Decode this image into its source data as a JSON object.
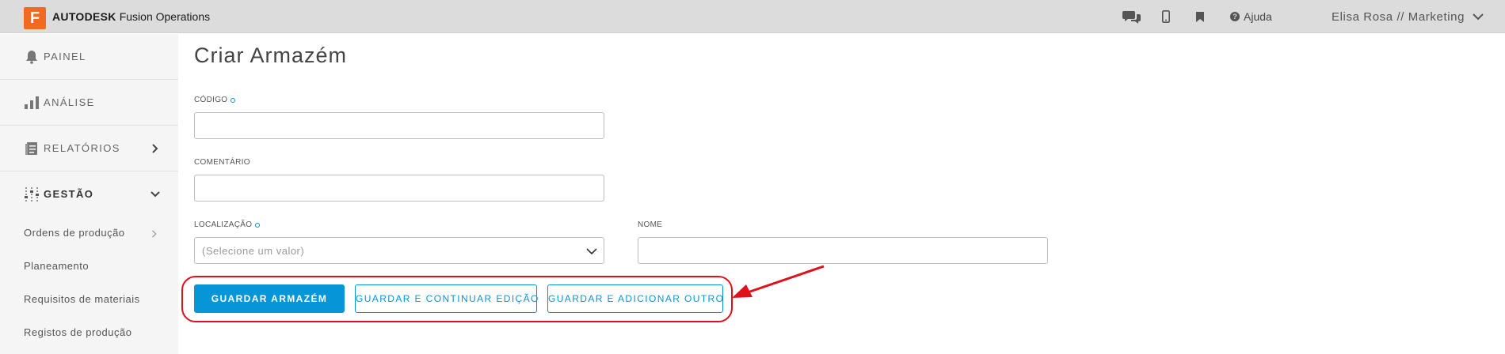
{
  "topbar": {
    "logo_letter": "F",
    "brand_name": "AUTODESK",
    "product_name": "Fusion Operations",
    "help_label": "Ajuda",
    "user_label": "Elisa Rosa // Marketing",
    "icons": [
      "chat-icon",
      "mobile-icon",
      "bookmark-icon",
      "help-icon",
      "chevron-down-icon"
    ]
  },
  "sidebar": {
    "items": [
      {
        "label": "PAINEL",
        "icon": "bell-icon"
      },
      {
        "label": "ANÁLISE",
        "icon": "bar-chart-icon"
      },
      {
        "label": "RELATÓRIOS",
        "icon": "report-icon"
      },
      {
        "label": "GESTÃO",
        "icon": "sliders-icon"
      }
    ],
    "subitems": [
      {
        "label": "Ordens de produção"
      },
      {
        "label": "Planeamento"
      },
      {
        "label": "Requisitos de materiais"
      },
      {
        "label": "Registos de produção"
      }
    ]
  },
  "main": {
    "title": "Criar Armazém",
    "fields": {
      "codigo": {
        "label": "CÓDIGO",
        "required": true,
        "value": ""
      },
      "comentario": {
        "label": "COMENTÁRIO",
        "required": false,
        "value": ""
      },
      "localizacao": {
        "label": "LOCALIZAÇÃO",
        "required": true,
        "placeholder": "(Selecione um valor)"
      },
      "nome": {
        "label": "NOME",
        "required": false,
        "value": ""
      }
    },
    "buttons": {
      "save": "GUARDAR ARMAZÉM",
      "save_continue": "GUARDAR E CONTINUAR EDIÇÃO",
      "save_add": "GUARDAR E ADICIONAR OUTRO"
    }
  },
  "colors": {
    "accent": "#0696d7",
    "logo": "#f26a21",
    "topbar": "#dcdcdc",
    "sidebar": "#f5f5f5",
    "annotation": "#e0101b"
  }
}
